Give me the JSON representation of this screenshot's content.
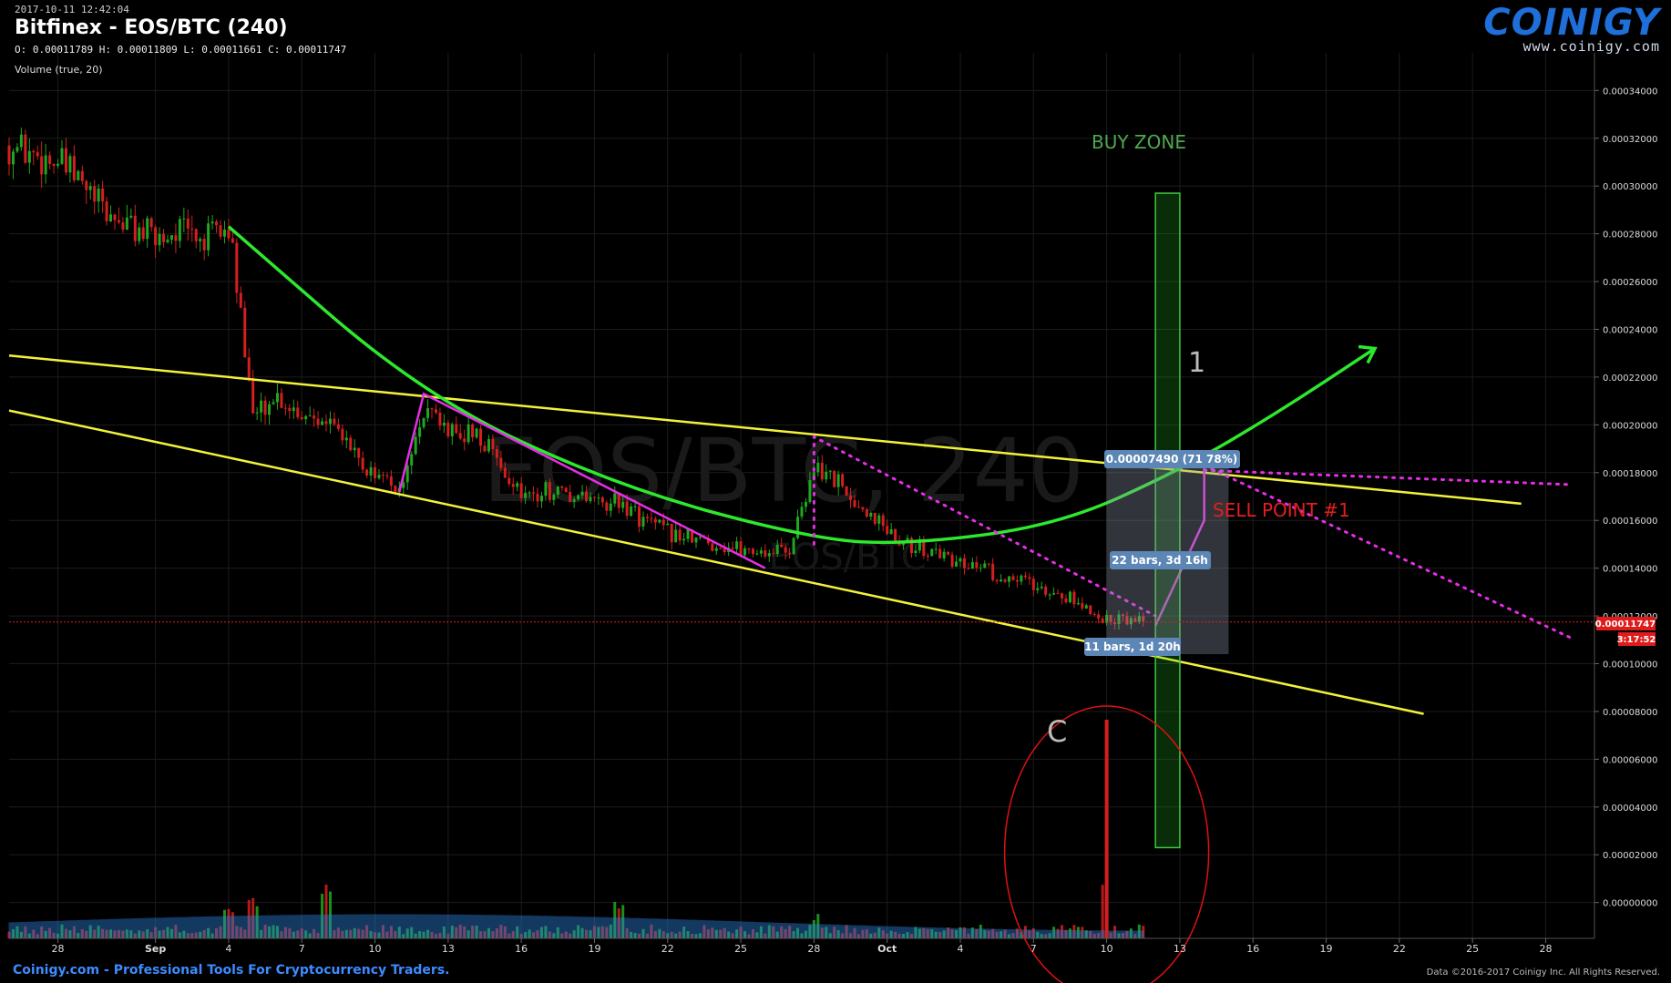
{
  "header": {
    "timestamp": "2017-10-11 12:42:04",
    "title": "Bitfinex - EOS/BTC (240)",
    "ohlc": "O: 0.00011789 H: 0.00011809 L: 0.00011661 C: 0.00011747",
    "volume_label": "Volume (true, 20)"
  },
  "logo": {
    "name": "COINIGY",
    "url": "www.coinigy.com"
  },
  "watermark": {
    "main": "EOS/BTC, 240",
    "sub": "EOS/BTC"
  },
  "footer": {
    "left": "Coinigy.com - Professional Tools For Cryptocurrency Traders.",
    "right": "Data ©2016-2017 Coinigy Inc. All Rights Reserved."
  },
  "colors": {
    "background": "#000000",
    "up": "#1fa81f",
    "down": "#d41f1f",
    "trendline": "#f2f23c",
    "curve": "#2ee82e",
    "magenta": "#e62ee6",
    "volume_ma": "#2a7fd4",
    "price_line": "#e02020"
  },
  "chart_data": {
    "type": "candlestick",
    "pair": "EOS/BTC",
    "exchange": "Bitfinex",
    "interval": "240",
    "y_axis": {
      "ticks": [
        "0.00034000",
        "0.00032000",
        "0.00030000",
        "0.00028000",
        "0.00026000",
        "0.00024000",
        "0.00022000",
        "0.00020000",
        "0.00018000",
        "0.00016000",
        "0.00014000",
        "0.00012000",
        "0.00010000",
        "0.00008000",
        "0.00006000",
        "0.00004000",
        "0.00002000",
        "0.00000000"
      ],
      "range": [
        -1.5e-05,
        0.000355
      ],
      "side": "right"
    },
    "x_axis": {
      "ticks": [
        "28",
        "Sep",
        "4",
        "7",
        "10",
        "13",
        "16",
        "19",
        "22",
        "25",
        "28",
        "Oct",
        "4",
        "7",
        "10",
        "13",
        "16",
        "19",
        "22",
        "25",
        "28"
      ],
      "start_date": "2017-08-26",
      "end_date": "2017-10-30"
    },
    "grid": true,
    "price_path": [
      [
        "2017-08-26",
        0.000317
      ],
      [
        "2017-08-28",
        0.00031
      ],
      [
        "2017-08-29",
        0.0003
      ],
      [
        "2017-08-30",
        0.000288
      ],
      [
        "2017-09-01",
        0.000278
      ],
      [
        "2017-09-02",
        0.000282
      ],
      [
        "2017-09-03",
        0.000277
      ],
      [
        "2017-09-04",
        0.000283
      ],
      [
        "2017-09-05",
        0.000205
      ],
      [
        "2017-09-06",
        0.000212
      ],
      [
        "2017-09-07",
        0.000205
      ],
      [
        "2017-09-08",
        0.000205
      ],
      [
        "2017-09-09",
        0.00019
      ],
      [
        "2017-09-10",
        0.000178
      ],
      [
        "2017-09-11",
        0.000172
      ],
      [
        "2017-09-12",
        0.000208
      ],
      [
        "2017-09-13",
        0.000195
      ],
      [
        "2017-09-14",
        0.000198
      ],
      [
        "2017-09-15",
        0.000185
      ],
      [
        "2017-09-16",
        0.00017
      ],
      [
        "2017-09-17",
        0.000172
      ],
      [
        "2017-09-18",
        0.00017
      ],
      [
        "2017-09-19",
        0.000168
      ],
      [
        "2017-09-20",
        0.000168
      ],
      [
        "2017-09-21",
        0.00016
      ],
      [
        "2017-09-22",
        0.000155
      ],
      [
        "2017-09-23",
        0.000152
      ],
      [
        "2017-09-24",
        0.00015
      ],
      [
        "2017-09-25",
        0.000148
      ],
      [
        "2017-09-26",
        0.000147
      ],
      [
        "2017-09-27",
        0.000148
      ],
      [
        "2017-09-28",
        0.000183
      ],
      [
        "2017-09-29",
        0.000175
      ],
      [
        "2017-09-30",
        0.000165
      ],
      [
        "2017-10-01",
        0.000157
      ],
      [
        "2017-10-02",
        0.00015
      ],
      [
        "2017-10-03",
        0.000146
      ],
      [
        "2017-10-04",
        0.000143
      ],
      [
        "2017-10-05",
        0.000139
      ],
      [
        "2017-10-06",
        0.000136
      ],
      [
        "2017-10-07",
        0.000134
      ],
      [
        "2017-10-08",
        0.00013
      ],
      [
        "2017-10-09",
        0.000125
      ],
      [
        "2017-10-10",
        0.000118
      ],
      [
        "2017-10-11",
        0.0001175
      ]
    ],
    "volume_spikes": [
      [
        "2017-09-04",
        0.4
      ],
      [
        "2017-09-05",
        0.6
      ],
      [
        "2017-09-08",
        0.8
      ],
      [
        "2017-09-28",
        0.35
      ],
      [
        "2017-09-20",
        0.5
      ],
      [
        "2017-10-10",
        1.0
      ]
    ],
    "last_price": "0.00011747",
    "countdown": "3:17:52",
    "annotations": {
      "buy_zone": "BUY ZONE",
      "sell_point": "SELL POINT #1",
      "label_1": "1",
      "label_c": "C",
      "measure_price": "0.00007490 (71 78%)",
      "measure_bars_long": "22 bars, 3d 16h",
      "measure_bars_short": "11 bars, 1d 20h"
    },
    "drawings": {
      "upper_trend": [
        [
          "2017-08-26",
          0.000229
        ],
        [
          "2017-10-27",
          0.000167
        ]
      ],
      "lower_trend": [
        [
          "2017-08-26",
          0.000206
        ],
        [
          "2017-10-23",
          7.9e-05
        ]
      ],
      "green_curve": [
        [
          "2017-09-04",
          0.000283
        ],
        [
          "2017-09-12",
          0.000212
        ],
        [
          "2017-09-20",
          0.000174
        ],
        [
          "2017-09-28",
          0.000152
        ],
        [
          "2017-10-02",
          0.00015
        ],
        [
          "2017-10-08",
          0.000158
        ],
        [
          "2017-10-13",
          0.000181
        ],
        [
          "2017-10-17",
          0.000205
        ],
        [
          "2017-10-21",
          0.000232
        ]
      ],
      "magenta_lines": [
        [
          [
            "2017-09-11",
            0.000172
          ],
          [
            "2017-09-12",
            0.000213
          ],
          [
            "2017-09-26",
            0.00014
          ]
        ],
        [
          [
            "2017-10-12",
            0.000116
          ],
          [
            "2017-10-14",
            0.00016
          ],
          [
            "2017-10-14",
            0.000182
          ]
        ]
      ],
      "magenta_dotted": [
        [
          [
            "2017-09-28",
            0.00015
          ],
          [
            "2017-09-28",
            0.000195
          ],
          [
            "2017-10-12",
            0.00012
          ]
        ],
        [
          [
            "2017-10-14",
            0.000181
          ],
          [
            "2017-10-29",
            0.000175
          ]
        ],
        [
          [
            "2017-10-14",
            0.000183
          ],
          [
            "2017-10-29",
            0.000111
          ]
        ]
      ],
      "buy_zone_rect": [
        [
          "2017-10-12",
          0.000297
        ],
        [
          "2017-10-13",
          2.3e-05
        ]
      ],
      "measure_box": [
        [
          "2017-10-10",
          0.000104
        ],
        [
          "2017-10-15",
          0.000183
        ]
      ]
    }
  }
}
